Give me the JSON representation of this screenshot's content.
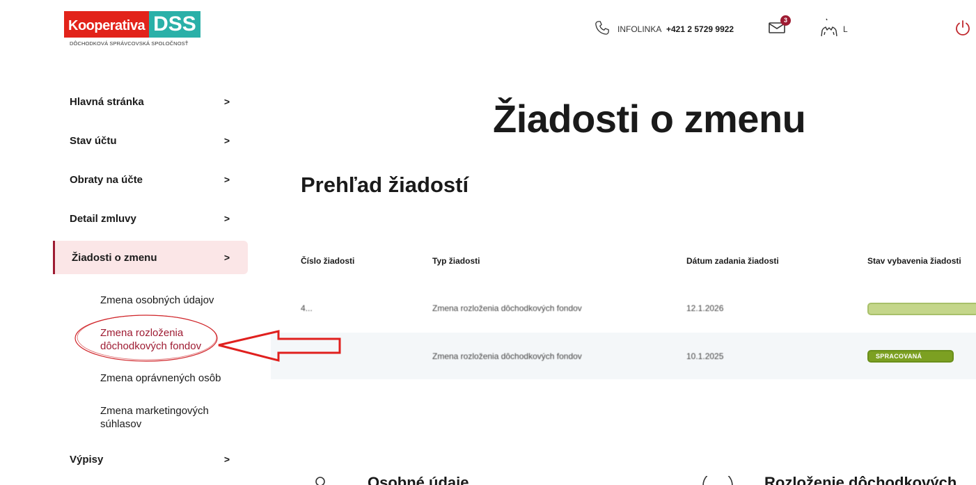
{
  "brand": {
    "name_left": "Kooperativa",
    "name_right": "DSS",
    "subtitle": "DÔCHODKOVÁ SPRÁVCOVSKÁ SPOLOČNOSŤ",
    "red": "#e2231a",
    "teal": "#2ab0a8",
    "accent": "#9e1b32"
  },
  "header": {
    "infolinka_label": "INFOLINKA",
    "infolinka_number": "+421 2 5729 9922",
    "mail_count": "3",
    "user_name": "L"
  },
  "sidebar": {
    "items": [
      {
        "label": "Hlavná stránka",
        "chevron": ">"
      },
      {
        "label": "Stav účtu",
        "chevron": ">"
      },
      {
        "label": "Obraty na účte",
        "chevron": ">"
      },
      {
        "label": "Detail zmluvy",
        "chevron": ">"
      },
      {
        "label": "Žiadosti o zmenu",
        "chevron": ">"
      }
    ],
    "sub_items": [
      {
        "label": "Zmena osobných údajov"
      },
      {
        "label": "Zmena rozloženia dôchodkových fondov"
      },
      {
        "label": "Zmena oprávnených osôb"
      },
      {
        "label": "Zmena marketingových súhlasov"
      }
    ],
    "last_item": {
      "label": "Výpisy",
      "chevron": ">"
    }
  },
  "main": {
    "page_title": "Žiadosti o zmenu",
    "section_title": "Prehľad žiadostí",
    "table": {
      "headers": [
        "Číslo žiadosti",
        "Typ žiadosti",
        "Dátum zadania žiadosti",
        "Stav vybavenia žiadosti"
      ],
      "rows": [
        {
          "number": "4...",
          "type": "Zmena rozloženia dôchodkových fondov",
          "date": "12.1.2026",
          "status": ""
        },
        {
          "number": "",
          "type": "Zmena rozloženia dôchodkových fondov",
          "date": "10.1.2025",
          "status": "SPRACOVANÁ"
        }
      ]
    },
    "cards": [
      {
        "title": "Osobné údaje"
      },
      {
        "title": "Rozloženie dôchodkových"
      }
    ]
  }
}
